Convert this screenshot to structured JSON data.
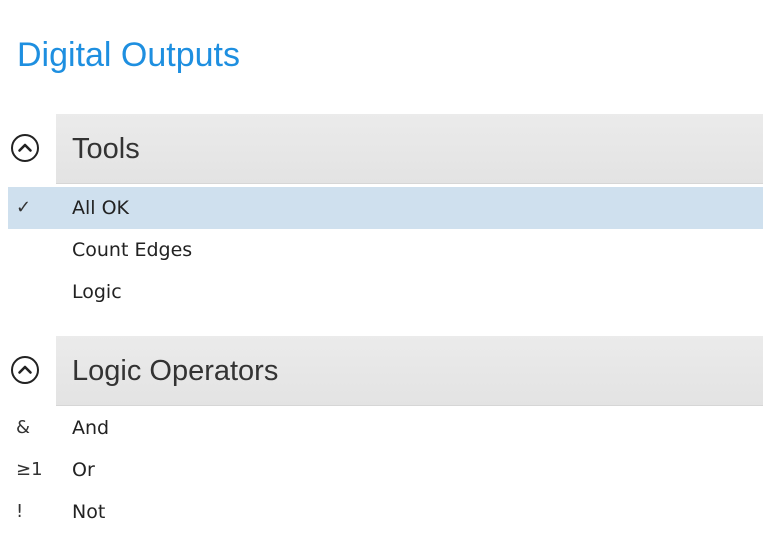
{
  "page": {
    "title": "Digital Outputs"
  },
  "sections": [
    {
      "title": "Tools",
      "toggle_icon": "chevron-up-circle-icon",
      "expanded": true,
      "items": [
        {
          "glyph": "✓",
          "glyph_icon": "checkmark-icon",
          "label": "All OK",
          "selected": true
        },
        {
          "glyph": "",
          "label": "Count Edges",
          "selected": false
        },
        {
          "glyph": "",
          "label": "Logic",
          "selected": false
        }
      ]
    },
    {
      "title": "Logic Operators",
      "toggle_icon": "chevron-up-circle-icon",
      "expanded": true,
      "items": [
        {
          "glyph": "&",
          "label": "And",
          "selected": false
        },
        {
          "glyph": "≥1",
          "label": "Or",
          "selected": false
        },
        {
          "glyph": "!",
          "label": "Not",
          "selected": false
        }
      ]
    }
  ],
  "colors": {
    "title_blue": "#1e8fe0",
    "header_band": "#e6e6e6",
    "selection": "#cfe0ee",
    "text": "#222222"
  }
}
